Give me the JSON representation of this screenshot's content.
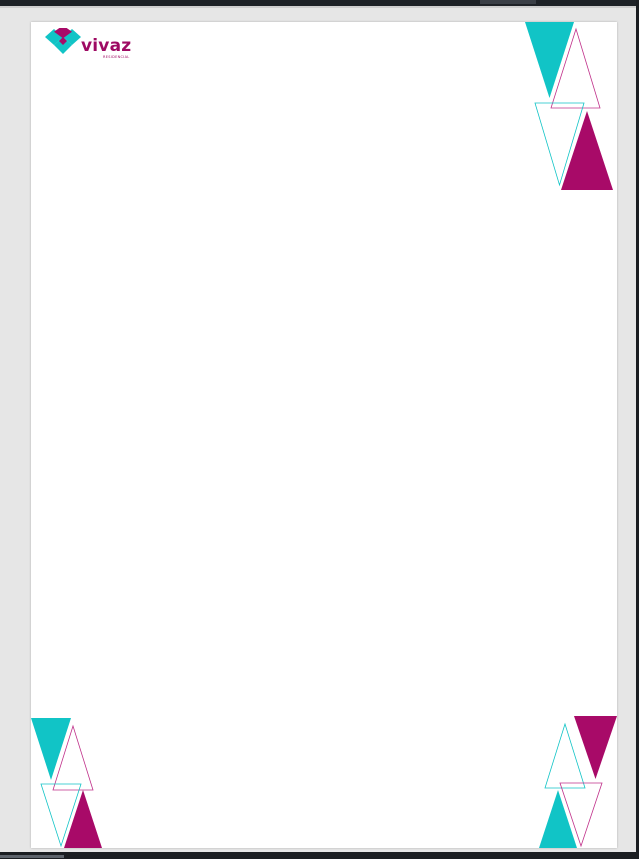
{
  "document": {
    "logo": {
      "wordmark": "vivaz",
      "tagline": "RESIDENCIAL"
    }
  },
  "colors": {
    "teal": "#11c4c6",
    "magenta": "#a80a68",
    "page_background": "#ffffff",
    "window_background": "#e6e6e6"
  },
  "decorations": [
    {
      "name": "corner-triangles-top-right",
      "icon": "triangles-pattern"
    },
    {
      "name": "corner-triangles-bottom-left",
      "icon": "triangles-pattern"
    },
    {
      "name": "corner-triangles-bottom-right",
      "icon": "triangles-pattern"
    }
  ]
}
